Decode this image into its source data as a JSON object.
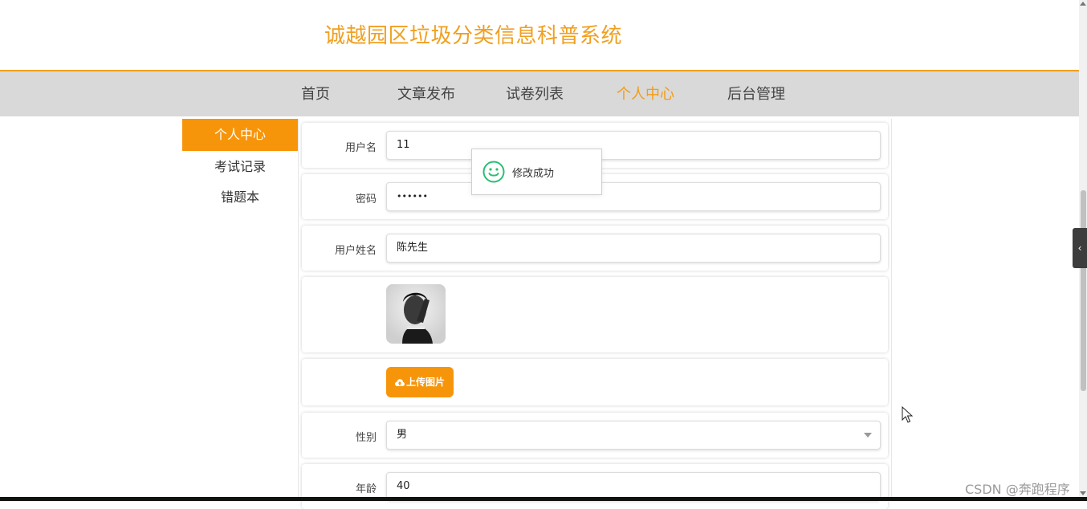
{
  "header": {
    "title": "诚越园区垃圾分类信息科普系统"
  },
  "nav": {
    "items": [
      {
        "label": "首页",
        "active": false
      },
      {
        "label": "文章发布",
        "active": false
      },
      {
        "label": "试卷列表",
        "active": false
      },
      {
        "label": "个人中心",
        "active": true
      },
      {
        "label": "后台管理",
        "active": false
      }
    ]
  },
  "sidebar": {
    "items": [
      {
        "label": "个人中心",
        "active": true
      },
      {
        "label": "考试记录",
        "active": false
      },
      {
        "label": "错题本",
        "active": false
      }
    ]
  },
  "form": {
    "username": {
      "label": "用户名",
      "value": "11"
    },
    "password": {
      "label": "密码",
      "value": "••••••"
    },
    "fullname": {
      "label": "用户姓名",
      "value": "陈先生"
    },
    "avatar": {
      "icon": "avatar-photo"
    },
    "upload": {
      "label": "上传图片",
      "icon": "cloud-upload-icon"
    },
    "gender": {
      "label": "性别",
      "value": "男"
    },
    "age": {
      "label": "年龄",
      "value": "40"
    }
  },
  "toast": {
    "message": "修改成功",
    "icon": "smile-icon"
  },
  "watermark": "CSDN @奔跑程序",
  "colors": {
    "accent": "#f7950a",
    "title": "#f0a020",
    "nav_bg": "#d9d9d9",
    "success": "#2dbd74"
  }
}
